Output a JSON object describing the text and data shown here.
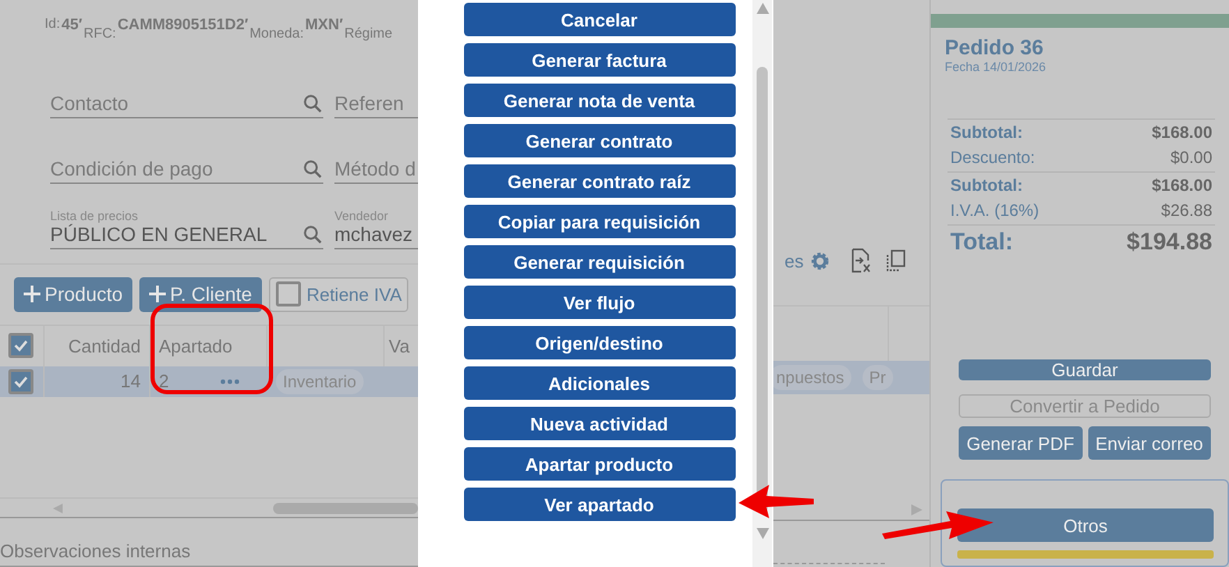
{
  "header": {
    "id_label": "Id:",
    "id": "45′",
    "rfc_label": "RFC:",
    "rfc": "CAMM8905151D2′",
    "currency_label": "Moneda:",
    "currency": "MXN′",
    "regime_label": "Régime"
  },
  "fields": [
    {
      "placeholder": "Contacto"
    },
    {
      "placeholder": "Referen"
    },
    {
      "placeholder": "Condición de pago"
    },
    {
      "placeholder": "Método d"
    },
    {
      "label": "Lista de precios",
      "value": "PÚBLICO EN GENERAL"
    },
    {
      "label": "Vendedor",
      "value": "mchavez"
    }
  ],
  "toolbar": {
    "buttons": [
      "Producto",
      "P. Cliente"
    ],
    "retiene_iva": {
      "label": "Retiene IVA",
      "checked": false
    },
    "settings_text": "es"
  },
  "table": {
    "all_checked": true,
    "columns": [
      "Cantidad",
      "Apartado",
      "Va"
    ],
    "rows": [
      {
        "checked": true,
        "cantidad": "14",
        "apartado": "2",
        "tags": [
          "Inventario",
          "npuestos",
          "Pr"
        ]
      }
    ]
  },
  "notes": {
    "placeholder": "Observaciones internas"
  },
  "menu": {
    "items": [
      "Cancelar",
      "Generar factura",
      "Generar nota de venta",
      "Generar contrato",
      "Generar contrato raíz",
      "Copiar para requisición",
      "Generar requisición",
      "Ver flujo",
      "Origen/destino",
      "Adicionales",
      "Nueva actividad",
      "Apartar producto",
      "Ver apartado"
    ]
  },
  "order": {
    "title": "Pedido 36",
    "date": "Fecha 14/01/2026",
    "totals": [
      {
        "kind": "strong",
        "label": "Subtotal:",
        "value": "$168.00"
      },
      {
        "kind": "plain",
        "label": "Descuento:",
        "value": "$0.00"
      },
      {
        "kind": "strong",
        "label": "Subtotal:",
        "value": "$168.00"
      },
      {
        "kind": "plain",
        "label": "I.V.A. (16%)",
        "value": "$26.88"
      },
      {
        "kind": "total",
        "label": "Total:",
        "value": "$194.88"
      }
    ]
  },
  "actions": {
    "save": "Guardar",
    "convert": {
      "label": "Convertir a Pedido",
      "disabled": true
    },
    "pdf": "Generar PDF",
    "email": "Enviar correo",
    "others": "Otros"
  }
}
